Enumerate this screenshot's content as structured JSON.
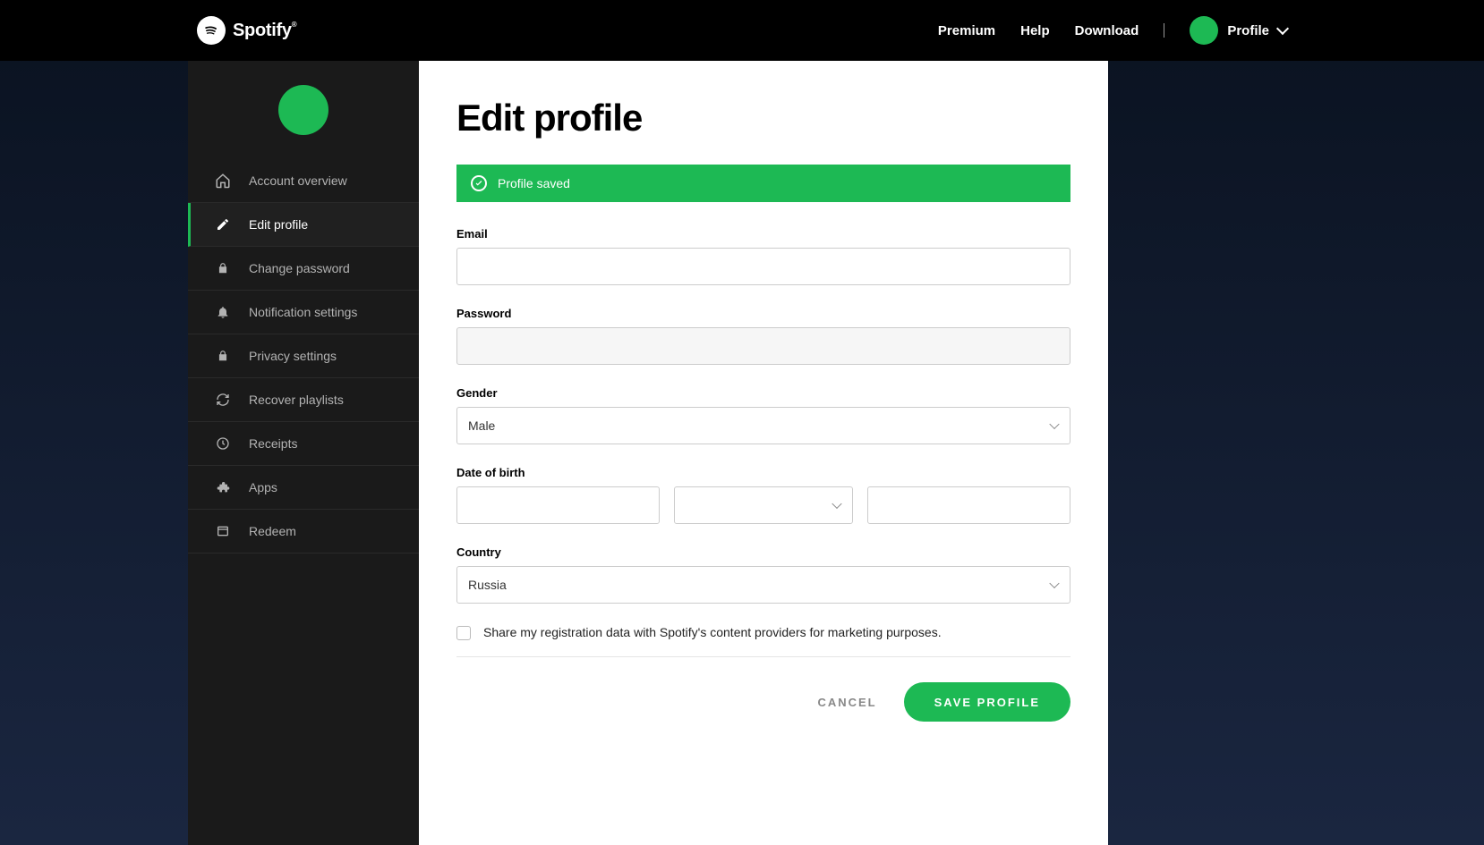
{
  "brand": {
    "name": "Spotify"
  },
  "nav": {
    "premium": "Premium",
    "help": "Help",
    "download": "Download",
    "profile": "Profile"
  },
  "sidebar": {
    "items": [
      {
        "label": "Account overview"
      },
      {
        "label": "Edit profile"
      },
      {
        "label": "Change password"
      },
      {
        "label": "Notification settings"
      },
      {
        "label": "Privacy settings"
      },
      {
        "label": "Recover playlists"
      },
      {
        "label": "Receipts"
      },
      {
        "label": "Apps"
      },
      {
        "label": "Redeem"
      }
    ]
  },
  "page": {
    "title": "Edit profile",
    "alert": "Profile saved"
  },
  "form": {
    "email_label": "Email",
    "email_value": "",
    "password_label": "Password",
    "password_value": "",
    "gender_label": "Gender",
    "gender_value": "Male",
    "dob_label": "Date of birth",
    "dob_day": "",
    "dob_month": "",
    "dob_year": "",
    "country_label": "Country",
    "country_value": "Russia",
    "share_label": "Share my registration data with Spotify's content providers for marketing purposes."
  },
  "actions": {
    "cancel": "CANCEL",
    "save": "SAVE PROFILE"
  },
  "colors": {
    "accent": "#1db954"
  }
}
